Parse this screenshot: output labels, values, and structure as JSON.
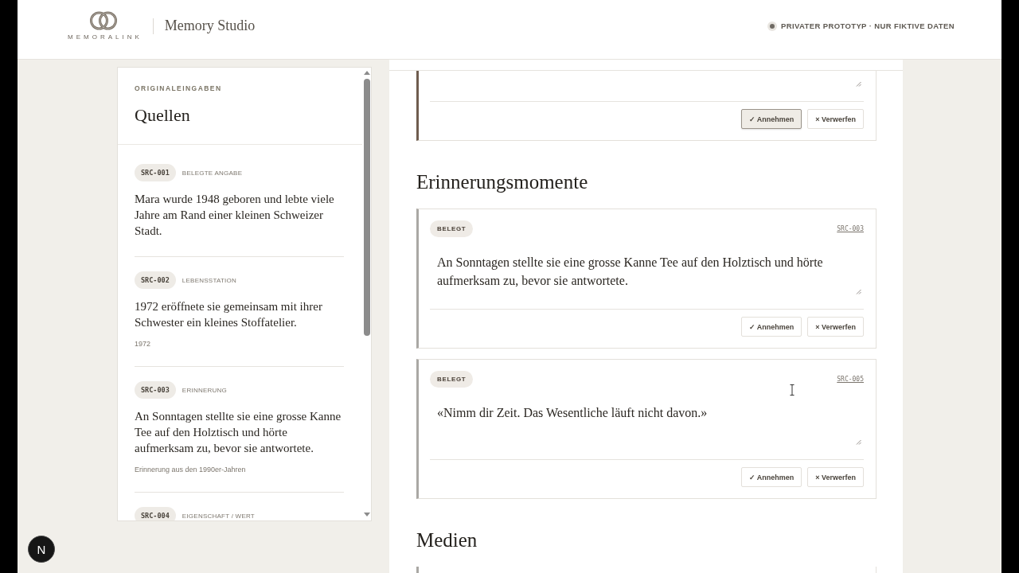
{
  "header": {
    "logo_text": "MEMORALINK",
    "app_title": "Memory Studio",
    "notice": "PRIVATER PROTOTYP · NUR FIKTIVE DATEN"
  },
  "sources_panel": {
    "eyebrow": "ORIGINALEINGABEN",
    "title": "Quellen",
    "items": [
      {
        "id": "SRC-001",
        "type": "BELEGTE ANGABE",
        "text": "Mara wurde 1948 geboren und lebte viele Jahre am Rand einer kleinen Schweizer Stadt."
      },
      {
        "id": "SRC-002",
        "type": "LEBENSSTATION",
        "text": "1972 eröffnete sie gemeinsam mit ihrer Schwester ein kleines Stoffatelier.",
        "note": "1972"
      },
      {
        "id": "SRC-003",
        "type": "ERINNERUNG",
        "text": "An Sonntagen stellte sie eine grosse Kanne Tee auf den Holztisch und hörte aufmerksam zu, bevor sie antwortete.",
        "note": "Erinnerung aus den 1990er-Jahren"
      },
      {
        "id": "SRC-004",
        "type": "EIGENSCHAFT / WERT"
      }
    ]
  },
  "editor": {
    "sections": [
      {
        "cards": [
          {
            "accepted": true,
            "accept_label": "✓ Annehmen",
            "reject_label": "× Verwerfen"
          }
        ]
      },
      {
        "title": "Erinnerungsmomente",
        "cards": [
          {
            "badge": "BELEGT",
            "source": "SRC-003",
            "text": "An Sonntagen stellte sie eine grosse Kanne Tee auf den Holztisch und hörte aufmerksam zu, bevor sie antwortete.",
            "accepted": false,
            "accept_label": "✓ Annehmen",
            "reject_label": "× Verwerfen"
          },
          {
            "badge": "BELEGT",
            "source": "SRC-005",
            "text": "«Nimm dir Zeit. Das Wesentliche läuft nicht davon.»",
            "accepted": false,
            "accept_label": "✓ Annehmen",
            "reject_label": "× Verwerfen"
          }
        ]
      },
      {
        "title": "Medien",
        "cards": [
          {
            "accepted": false
          }
        ]
      }
    ]
  },
  "dev_button": {
    "label": "N"
  }
}
